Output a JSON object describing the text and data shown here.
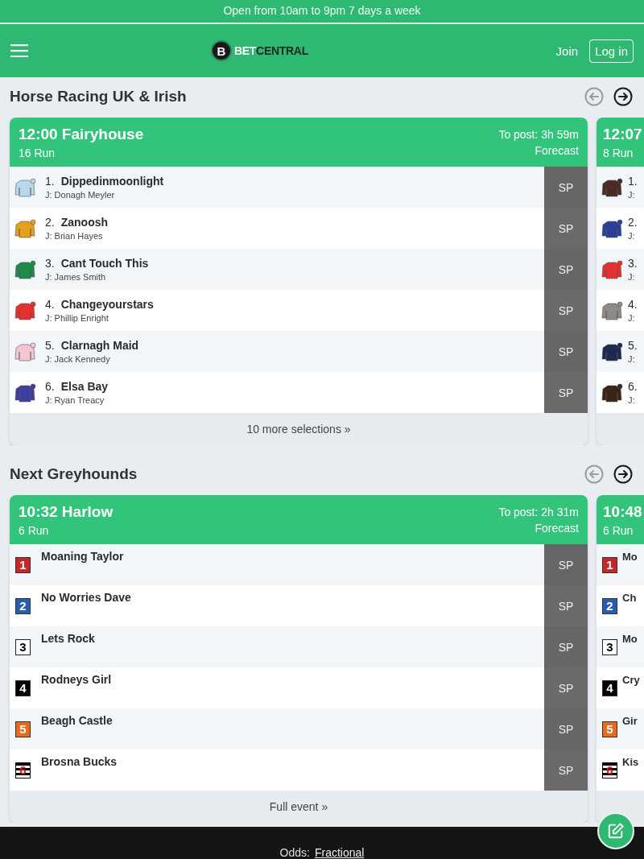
{
  "top_banner": "Open from 10am to 9pm 7 days a week",
  "header": {
    "logo": {
      "mark": "B",
      "bet": "BET",
      "central": "CENTRAL"
    },
    "links": [
      {
        "label": "Join",
        "kind": "link"
      },
      {
        "label": "Log in",
        "kind": "outlined"
      }
    ]
  },
  "sections": [
    {
      "title": "Horse Racing UK & Irish",
      "kind": "horse",
      "nav": {
        "prev_disabled": true,
        "next_disabled": false
      },
      "cards": [
        {
          "title": "12:00 Fairyhouse",
          "runners_count": "16 Run",
          "to_post": "To post: 3h 59m",
          "market": "Forecast",
          "footer_link": "10 more selections »",
          "runners": [
            {
              "number": "1.",
              "name": "Dippedinmoonlight",
              "jockey": "J: Donagh Meyler",
              "price": "SP",
              "color": "#b9d9ea"
            },
            {
              "number": "2.",
              "name": "Zanoosh",
              "jockey": "J: Brian Hayes",
              "price": "SP",
              "color": "#e6a020"
            },
            {
              "number": "3.",
              "name": "Cant Touch This",
              "jockey": "J: James Smith",
              "price": "SP",
              "color": "#1f8a4c"
            },
            {
              "number": "4.",
              "name": "Changeyourstars",
              "jockey": "J: Phillip Enright",
              "price": "SP",
              "color": "#e53030"
            },
            {
              "number": "5.",
              "name": "Clarnagh Maid",
              "jockey": "J: Jack Kennedy",
              "price": "SP",
              "color": "#f4c6d2"
            },
            {
              "number": "6.",
              "name": "Elsa Bay",
              "jockey": "J: Ryan Treacy",
              "price": "SP",
              "color": "#3c3f9e"
            }
          ]
        },
        {
          "title": "12:07",
          "runners_count": "8 Run",
          "runners": [
            {
              "number": "1.",
              "jockey": "J:",
              "color": "#4a2a22"
            },
            {
              "number": "2.",
              "jockey": "J:",
              "color": "#2b3f9a"
            },
            {
              "number": "3.",
              "jockey": "J:",
              "color": "#e53030"
            },
            {
              "number": "4.",
              "jockey": "J:",
              "color": "#8e8a88"
            },
            {
              "number": "5.",
              "jockey": "J:",
              "color": "#1d2a4d"
            },
            {
              "number": "6.",
              "jockey": "J:",
              "color": "#3a2415"
            }
          ]
        }
      ]
    },
    {
      "title": "Next Greyhounds",
      "kind": "greyhound",
      "nav": {
        "prev_disabled": true,
        "next_disabled": false
      },
      "cards": [
        {
          "title": "10:32 Harlow",
          "runners_count": "6 Run",
          "to_post": "To post: 2h 31m",
          "market": "Forecast",
          "footer_link": "Full event »",
          "runners": [
            {
              "trap": "1",
              "name": "Moaning Taylor",
              "price": "SP",
              "color": "#c62828",
              "kind": "solid"
            },
            {
              "trap": "2",
              "name": "No Worries Dave",
              "price": "SP",
              "color": "#2a5caa",
              "kind": "solid"
            },
            {
              "trap": "3",
              "name": "Lets Rock",
              "price": "SP",
              "color": "#ffffff",
              "kind": "solid"
            },
            {
              "trap": "4",
              "name": "Rodneys Girl",
              "price": "SP",
              "color": "#000000",
              "kind": "solid"
            },
            {
              "trap": "5",
              "name": "Beagh Castle",
              "price": "SP",
              "color": "#e86a1c",
              "kind": "solid"
            },
            {
              "trap": "6",
              "name": "Brosna Bucks",
              "price": "SP",
              "color": "#000000",
              "kind": "striped"
            }
          ]
        },
        {
          "title": "10:48",
          "runners_count": "6 Run",
          "runners": [
            {
              "trap": "1",
              "name": "Mo",
              "color": "#c62828",
              "kind": "solid"
            },
            {
              "trap": "2",
              "name": "Ch",
              "color": "#2a5caa",
              "kind": "solid"
            },
            {
              "trap": "3",
              "name": "Mo",
              "color": "#ffffff",
              "kind": "solid"
            },
            {
              "trap": "4",
              "name": "Cry",
              "color": "#000000",
              "kind": "solid"
            },
            {
              "trap": "5",
              "name": "Gir",
              "color": "#e86a1c",
              "kind": "solid"
            },
            {
              "trap": "6",
              "name": "Kis",
              "color": "#000000",
              "kind": "striped"
            }
          ]
        }
      ]
    }
  ],
  "footer": {
    "label": "Odds:",
    "value": "Fractional"
  }
}
